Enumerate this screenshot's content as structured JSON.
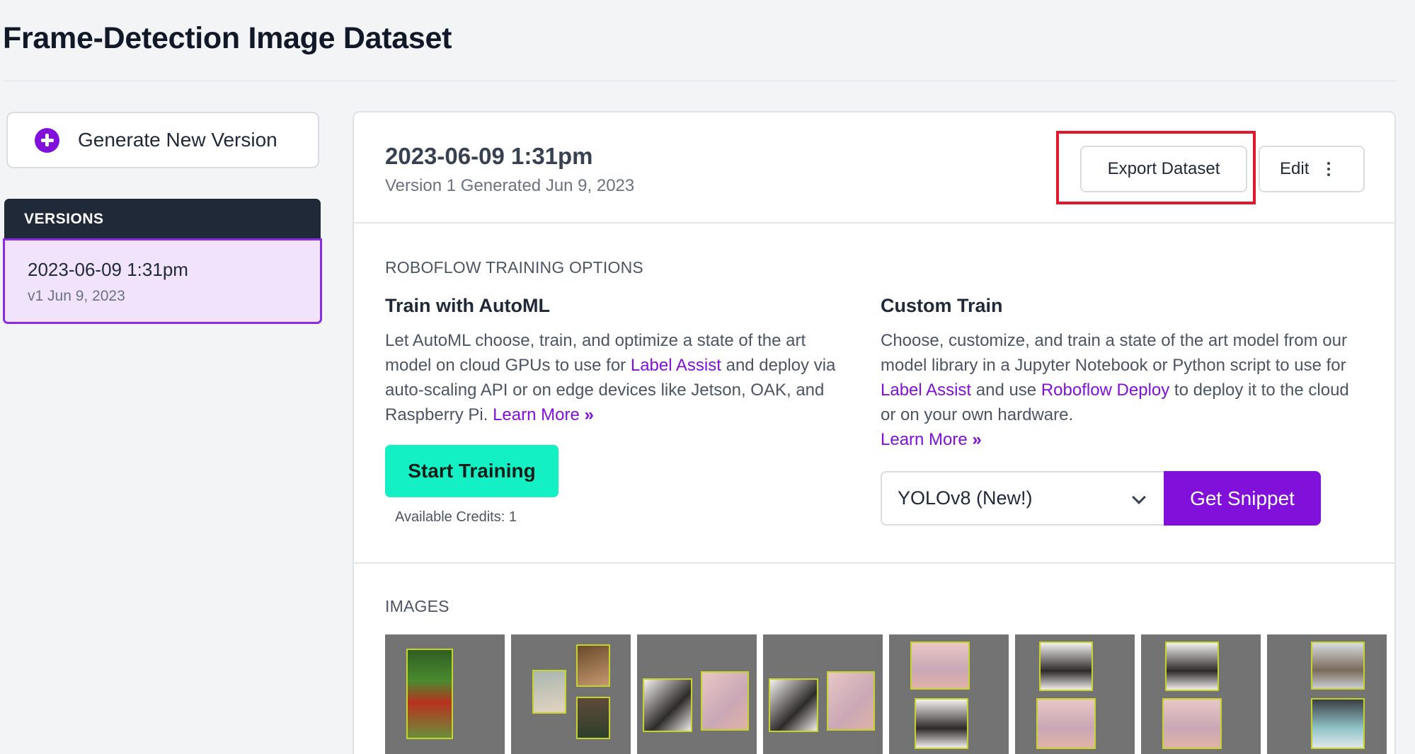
{
  "page": {
    "title": "Frame-Detection Image Dataset"
  },
  "sidebar": {
    "generate_button": "Generate New Version",
    "versions_header": "VERSIONS",
    "versions": [
      {
        "date": "2023-06-09 1:31pm",
        "sub": "v1 Jun 9, 2023"
      }
    ]
  },
  "version": {
    "title": "2023-06-09 1:31pm",
    "subtitle": "Version 1 Generated Jun 9, 2023",
    "export_button": "Export Dataset",
    "edit_button": "Edit"
  },
  "training": {
    "section_label": "ROBOFLOW TRAINING OPTIONS",
    "automl": {
      "title": "Train with AutoML",
      "text1": "Let AutoML choose, train, and optimize a state of the art model on cloud GPUs to use for ",
      "link_label_assist": "Label Assist",
      "text2": " and deploy via auto-scaling API or on edge devices like Jetson, OAK, and Raspberry Pi. ",
      "learn_more": "Learn More",
      "chevron": "»",
      "start_button": "Start Training",
      "credits": "Available Credits: 1"
    },
    "custom": {
      "title": "Custom Train",
      "text1": "Choose, customize, and train a state of the art model from our model library in a Jupyter Notebook or Python script to use for ",
      "link_label_assist": "Label Assist",
      "text2": " and use ",
      "link_deploy": "Roboflow Deploy",
      "text3": " to deploy it to the cloud or on your own hardware.",
      "learn_more": "Learn More",
      "chevron": "»",
      "model_selected": "YOLOv8 (New!)",
      "snippet_button": "Get Snippet"
    }
  },
  "images": {
    "section_label": "IMAGES",
    "count_visible": 8
  },
  "colors": {
    "accent": "#8110db",
    "start": "#13f0c4",
    "highlight": "#e3182d"
  }
}
